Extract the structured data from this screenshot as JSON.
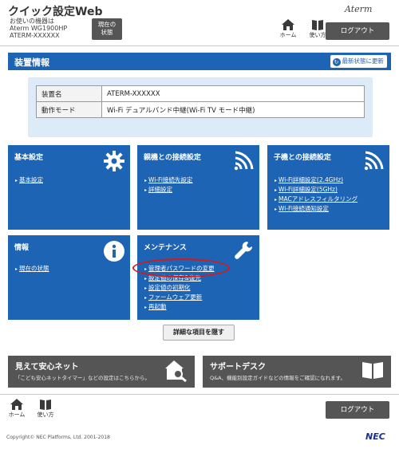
{
  "header": {
    "app_title": "クイック設定Web",
    "device_label": "お使いの機器は",
    "device_model": "Aterm WG1900HP",
    "device_name": "ATERM-XXXXXX",
    "current_status_button": "現在の\n状態",
    "brand": "Aterm",
    "home_label": "ホーム",
    "manual_label": "使い方",
    "logout_label": "ログアウト"
  },
  "main": {
    "title": "装置情報",
    "refresh_label": "最新状態に更新",
    "info_rows": [
      {
        "key": "装置名",
        "value": "ATERM-XXXXXX"
      },
      {
        "key": "動作モード",
        "value": "Wi-Fi デュアルバンド中継(Wi-Fi TV モード中継)"
      }
    ]
  },
  "tiles": {
    "basic": {
      "title": "基本設定",
      "links": [
        "基本設定"
      ]
    },
    "parent": {
      "title": "親機との接続設定",
      "links": [
        "Wi-Fi接続先設定",
        "詳細設定"
      ]
    },
    "child": {
      "title": "子機との接続設定",
      "links": [
        "Wi-Fi詳細設定(2.4GHz)",
        "Wi-Fi詳細設定(5GHz)",
        "MACアドレスフィルタリング",
        "Wi-Fi接続通知設定"
      ]
    },
    "info": {
      "title": "情報",
      "links": [
        "現在の状態"
      ]
    },
    "maintenance": {
      "title": "メンテナンス",
      "links": [
        "管理者パスワードの変更",
        "設定値の保存&復元",
        "設定値の初期化",
        "ファームウェア更新",
        "再起動"
      ]
    }
  },
  "advanced_button": "詳細な項目を隠す",
  "banners": {
    "watch": {
      "title": "見えて安心ネット",
      "desc": "「こども安心ネットタイマー」などの設定はこちらから。"
    },
    "support": {
      "title": "サポートデスク",
      "desc": "Q&A、機能別設定ガイドなどの情報をご確認になれます。"
    }
  },
  "footer": {
    "home_label": "ホーム",
    "manual_label": "使い方",
    "logout_label": "ログアウト",
    "copyright": "Copyright© NEC Platforms, Ltd. 2001-2018",
    "brand": "NEC"
  },
  "colors": {
    "accent": "#1e64b4",
    "dark_button": "#555555",
    "highlight": "#d81818",
    "panel": "#ddeaf7"
  },
  "icons": [
    "home-icon",
    "book-icon",
    "gear-icon",
    "wifi-icon",
    "info-icon",
    "wrench-icon",
    "house-search-icon",
    "open-book-icon",
    "refresh-icon"
  ]
}
